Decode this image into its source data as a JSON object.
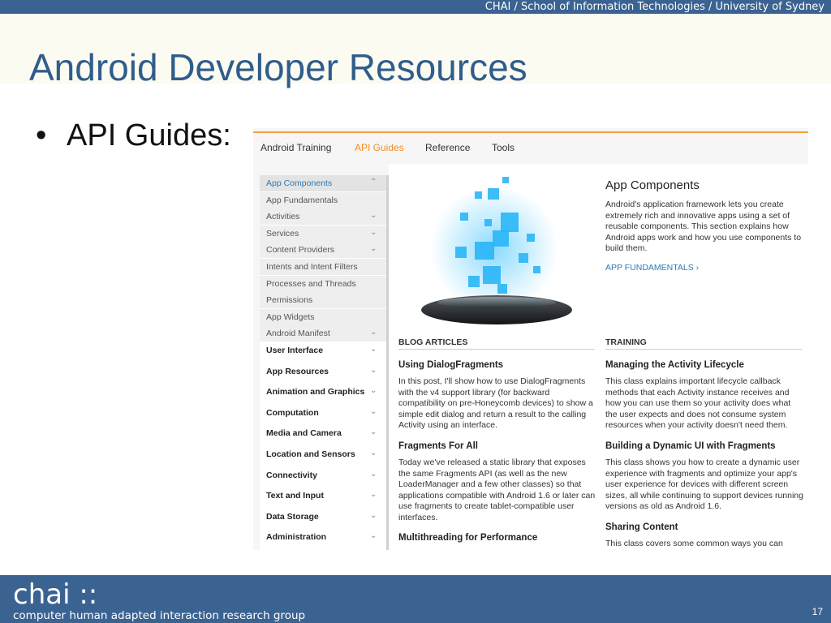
{
  "header": {
    "breadcrumb": "CHAI / School of Information Technologies / University of Sydney",
    "title": "Android Developer Resources"
  },
  "content": {
    "bullet_symbol": "•",
    "bullet_text": "API Guides:"
  },
  "screenshot": {
    "nav": [
      "Android Training",
      "API Guides",
      "Reference",
      "Tools"
    ],
    "active_nav": "API Guides",
    "sidebar": [
      {
        "label": "App Components",
        "chevron": "up"
      },
      {
        "label": "App Fundamentals",
        "chevron": ""
      },
      {
        "label": "Activities",
        "chevron": "down"
      },
      {
        "label": "Services",
        "chevron": "down"
      },
      {
        "label": "Content Providers",
        "chevron": "down"
      },
      {
        "label": "Intents and Intent Filters",
        "chevron": ""
      },
      {
        "label": "Processes and Threads",
        "chevron": ""
      },
      {
        "label": "Permissions",
        "chevron": ""
      },
      {
        "label": "App Widgets",
        "chevron": ""
      },
      {
        "label": "Android Manifest",
        "chevron": "down"
      },
      {
        "label": "User Interface",
        "chevron": "down"
      },
      {
        "label": "App Resources",
        "chevron": "down"
      },
      {
        "label": "Animation and Graphics",
        "chevron": "down"
      },
      {
        "label": "Computation",
        "chevron": "down"
      },
      {
        "label": "Media and Camera",
        "chevron": "down"
      },
      {
        "label": "Location and Sensors",
        "chevron": "down"
      },
      {
        "label": "Connectivity",
        "chevron": "down"
      },
      {
        "label": "Text and Input",
        "chevron": "down"
      },
      {
        "label": "Data Storage",
        "chevron": "down"
      },
      {
        "label": "Administration",
        "chevron": "down"
      }
    ],
    "app_components": {
      "title": "App Components",
      "description": "Android's application framework lets you create extremely rich and innovative apps using a set of reusable components. This section explains how Android apps work and how you use components to build them.",
      "link": "APP FUNDAMENTALS  ›"
    },
    "blog": {
      "heading": "BLOG ARTICLES",
      "articles": [
        {
          "title": "Using DialogFragments",
          "desc": "In this post, I'll show how to use DialogFragments with the v4 support library (for backward compatibility on pre-Honeycomb devices) to show a simple edit dialog and return a result to the calling Activity using an interface."
        },
        {
          "title": "Fragments For All",
          "desc": "Today we've released a static library that exposes the same Fragments API (as well as the new LoaderManager and a few other classes) so that applications compatible with Android 1.6 or later can use fragments to create tablet-compatible user interfaces."
        },
        {
          "title": "Multithreading for Performance",
          "desc": ""
        }
      ]
    },
    "training": {
      "heading": "TRAINING",
      "articles": [
        {
          "title": "Managing the Activity Lifecycle",
          "desc": "This class explains important lifecycle callback methods that each Activity instance receives and how you can use them so your activity does what the user expects and does not consume system resources when your activity doesn't need them."
        },
        {
          "title": "Building a Dynamic UI with Fragments",
          "desc": "This class shows you how to create a dynamic user experience with fragments and optimize your app's user experience for devices with different screen sizes, all while continuing to support devices running versions as old as Android 1.6."
        },
        {
          "title": "Sharing Content",
          "desc": "This class covers some common ways you can send"
        }
      ]
    }
  },
  "footer": {
    "brand": "chai ::",
    "tagline": "computer human adapted interaction research group",
    "page_number": "17"
  },
  "colors": {
    "bar_blue": "#3b6391",
    "title_blue": "#2f5d8c",
    "accent_orange": "#f0901e",
    "link_blue": "#2a7bb8"
  }
}
